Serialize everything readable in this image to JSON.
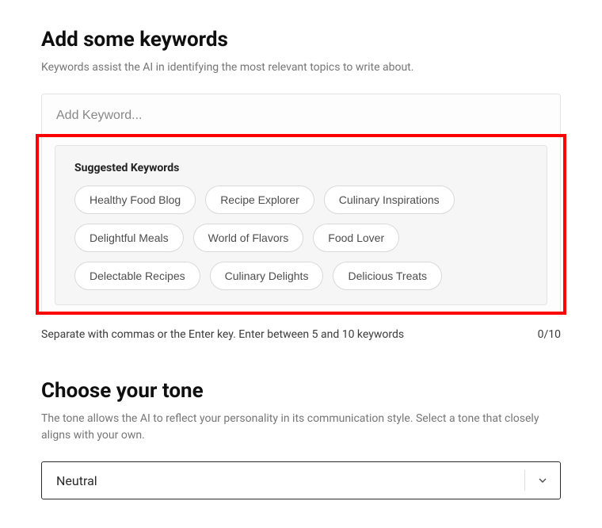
{
  "keywords": {
    "title": "Add some keywords",
    "subtitle": "Keywords assist the AI in identifying the most relevant topics to write about.",
    "input_placeholder": "Add Keyword...",
    "suggested_title": "Suggested Keywords",
    "suggested_rows": [
      [
        "Healthy Food Blog",
        "Recipe Explorer",
        "Culinary Inspirations"
      ],
      [
        "Delightful Meals",
        "World of Flavors",
        "Food Lover"
      ],
      [
        "Delectable Recipes",
        "Culinary Delights",
        "Delicious Treats"
      ]
    ],
    "helper_text": "Separate with commas or the Enter key. Enter between 5 and 10 keywords",
    "counter": "0/10"
  },
  "tone": {
    "title": "Choose your tone",
    "subtitle": "The tone allows the AI to reflect your personality in its communication style. Select a tone that closely aligns with your own.",
    "selected": "Neutral"
  }
}
